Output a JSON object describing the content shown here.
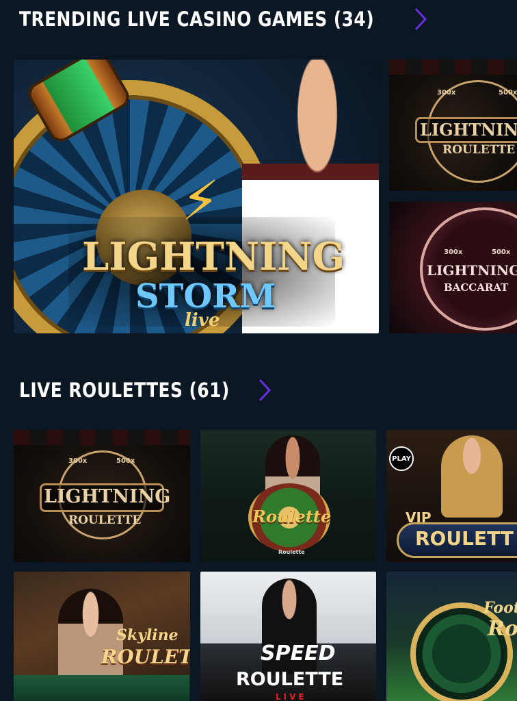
{
  "sections": {
    "trending": {
      "title": "TRENDING LIVE CASINO GAMES (34)"
    },
    "roulettes": {
      "title": "LIVE ROULETTES (61)"
    }
  },
  "games": {
    "storm": {
      "line1": "LIGHTNING",
      "line2": "STORM",
      "line3": "live"
    },
    "lightning_roulette_small": {
      "line1": "LIGHTNING",
      "line2": "ROULETTE",
      "m1": "300x",
      "m2": "500x"
    },
    "lightning_baccarat": {
      "line1": "LIGHTNING",
      "line2": "BACCARAT",
      "m1": "300x",
      "m2": "500x"
    },
    "lightning_roulette": {
      "line1": "LIGHTNING",
      "line2": "ROULETTE",
      "m1": "300x",
      "m2": "500x"
    },
    "roulette_green": {
      "line1": "Roulette",
      "caption": "Roulette"
    },
    "vip_roulette": {
      "line1": "VIP",
      "line2": "ROULETT",
      "badge": "PLAY"
    },
    "skyline": {
      "line1": "Skyline",
      "line2": "ROULETTE"
    },
    "speed": {
      "line1": "SPEED",
      "line2": "ROULETTE",
      "line3": "LIVE"
    },
    "football": {
      "line1": "Footba",
      "line2": "Rou"
    }
  },
  "colors": {
    "background": "#0b1824",
    "accent_chevron": "#6b2ee8",
    "title": "#ffffff"
  },
  "icons": {
    "chevron": "chevron-right-icon"
  }
}
